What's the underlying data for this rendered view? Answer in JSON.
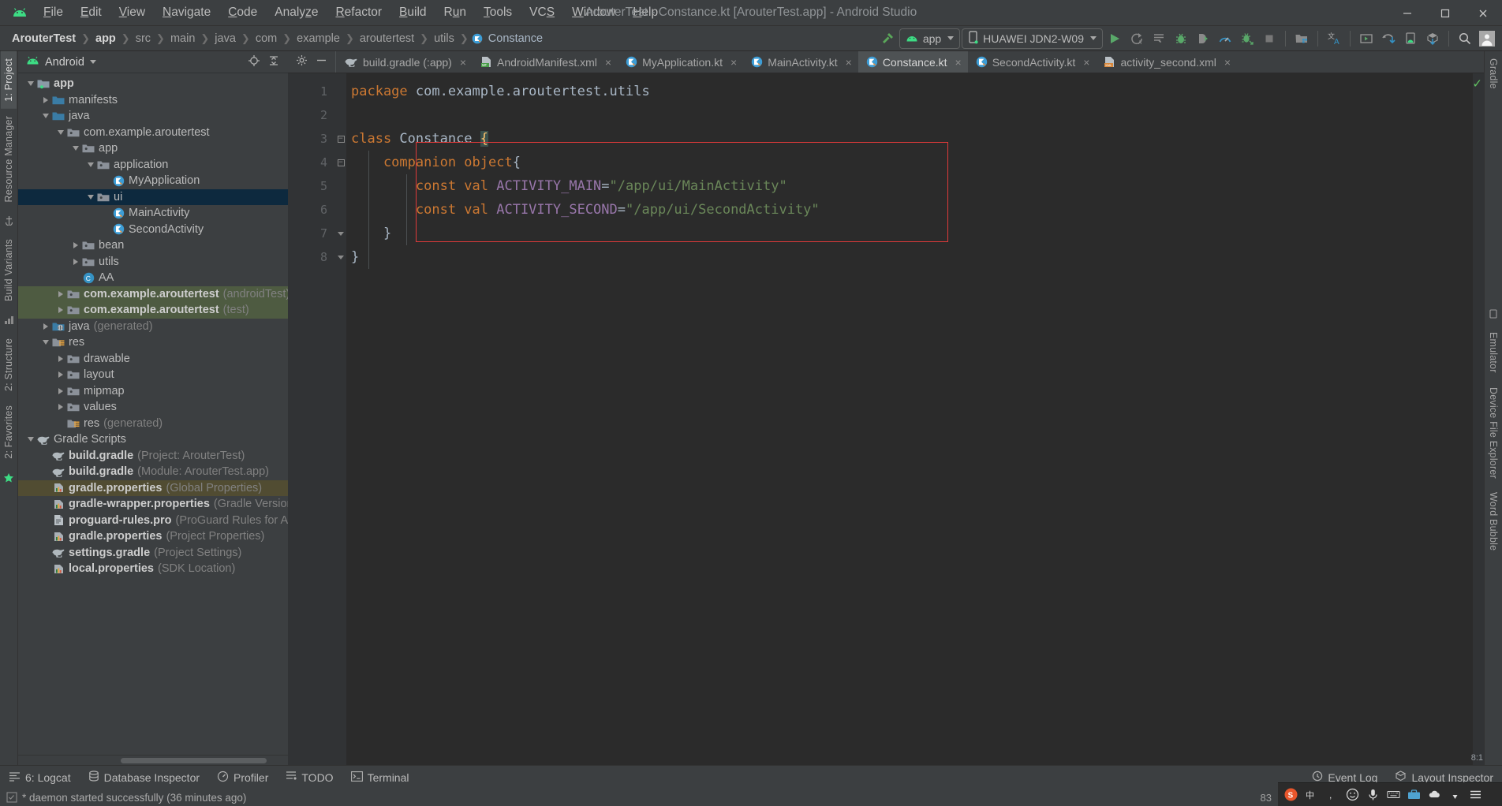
{
  "window": {
    "title": "ArouterTest - Constance.kt [ArouterTest.app] - Android Studio",
    "minimize": "—",
    "maximize": "☐",
    "close": "✕"
  },
  "menubar": {
    "logo": "android-logo-icon",
    "items": [
      {
        "label": "File",
        "mnemonic": "F"
      },
      {
        "label": "Edit",
        "mnemonic": "E"
      },
      {
        "label": "View",
        "mnemonic": "V"
      },
      {
        "label": "Navigate",
        "mnemonic": "N"
      },
      {
        "label": "Code",
        "mnemonic": "C"
      },
      {
        "label": "Analyze",
        "mnemonic": "z"
      },
      {
        "label": "Refactor",
        "mnemonic": "R"
      },
      {
        "label": "Build",
        "mnemonic": "B"
      },
      {
        "label": "Run",
        "mnemonic": "u"
      },
      {
        "label": "Tools",
        "mnemonic": "T"
      },
      {
        "label": "VCS",
        "mnemonic": "S"
      },
      {
        "label": "Window",
        "mnemonic": "W"
      },
      {
        "label": "Help",
        "mnemonic": "H"
      }
    ]
  },
  "breadcrumbs": [
    {
      "label": "ArouterTest",
      "style": "bold"
    },
    {
      "label": "app",
      "style": "bold"
    },
    {
      "label": "src",
      "style": "dim"
    },
    {
      "label": "main",
      "style": "dim"
    },
    {
      "label": "java",
      "style": "dim"
    },
    {
      "label": "com",
      "style": "dim"
    },
    {
      "label": "example",
      "style": "dim"
    },
    {
      "label": "aroutertest",
      "style": "dim"
    },
    {
      "label": "utils",
      "style": "dim"
    },
    {
      "label": "Constance",
      "style": "plain",
      "icon": "kotlin-class-icon"
    }
  ],
  "toolbar": {
    "build_hammer": "hammer-icon",
    "module_selector": {
      "label": "app",
      "icon": "android-app-icon"
    },
    "device_selector": {
      "label": "HUAWEI JDN2-W09",
      "icon": "device-phone-icon"
    },
    "actions": [
      {
        "name": "run-button",
        "icon": "play-icon"
      },
      {
        "name": "apply-changes-button",
        "icon": "apply-changes-icon"
      },
      {
        "name": "apply-code-changes-button",
        "icon": "apply-code-changes-icon"
      },
      {
        "name": "debug-button",
        "icon": "debug-bug-icon"
      },
      {
        "name": "attach-debugger-button",
        "icon": "attach-debugger-icon"
      },
      {
        "name": "profile-button",
        "icon": "profiler-gauge-icon"
      },
      {
        "name": "run-with-coverage-button",
        "icon": "coverage-icon"
      },
      {
        "name": "stop-button",
        "icon": "stop-square-icon"
      },
      {
        "name": "sdk-manager-button",
        "icon": "sdk-manager-icon"
      },
      {
        "name": "translate-button",
        "icon": "translate-icon"
      },
      {
        "name": "avd-manager-button",
        "icon": "avd-manager-icon"
      },
      {
        "name": "sync-gradle-button",
        "icon": "gradle-sync-icon"
      },
      {
        "name": "device-file-explorer-button",
        "icon": "device-explorer-icon"
      },
      {
        "name": "layout-inspector-button",
        "icon": "layout-inspector-icon"
      },
      {
        "name": "search-everywhere-button",
        "icon": "search-icon"
      },
      {
        "name": "account-button",
        "icon": "user-avatar-icon"
      }
    ]
  },
  "left_rail": {
    "tabs": [
      "1: Project",
      "Resource Manager",
      "Build Variants",
      "2: Structure",
      "2: Favorites"
    ],
    "bottom_icon": "favorites-star-icon"
  },
  "right_rail": {
    "tabs": [
      "Gradle",
      "Emulator",
      "Device File Explorer",
      "Word Bubble"
    ]
  },
  "project_panel": {
    "selector_label": "Android",
    "selector_icon": "android-logo-icon",
    "actions": [
      "locate-target-icon",
      "collapse-all-icon"
    ],
    "tree": [
      {
        "label": "app",
        "depth": 0,
        "twisty": "open",
        "icon": "module-folder-icon",
        "bold": true
      },
      {
        "label": "manifests",
        "depth": 1,
        "twisty": "closed",
        "icon": "folder-blue-icon"
      },
      {
        "label": "java",
        "depth": 1,
        "twisty": "open",
        "icon": "folder-blue-icon"
      },
      {
        "label": "com.example.aroutertest",
        "depth": 2,
        "twisty": "open",
        "icon": "package-icon"
      },
      {
        "label": "app",
        "depth": 3,
        "twisty": "open",
        "icon": "package-icon"
      },
      {
        "label": "application",
        "depth": 4,
        "twisty": "open",
        "icon": "package-icon"
      },
      {
        "label": "MyApplication",
        "depth": 5,
        "twisty": "none",
        "icon": "kotlin-class-icon"
      },
      {
        "label": "ui",
        "depth": 4,
        "twisty": "open",
        "icon": "package-icon",
        "selected": "blue"
      },
      {
        "label": "MainActivity",
        "depth": 5,
        "twisty": "none",
        "icon": "kotlin-class-icon"
      },
      {
        "label": "SecondActivity",
        "depth": 5,
        "twisty": "none",
        "icon": "kotlin-class-icon"
      },
      {
        "label": "bean",
        "depth": 3,
        "twisty": "closed",
        "icon": "package-icon"
      },
      {
        "label": "utils",
        "depth": 3,
        "twisty": "closed",
        "icon": "package-icon"
      },
      {
        "label": "AA",
        "depth": 3,
        "twisty": "none",
        "icon": "java-class-icon"
      },
      {
        "label": "com.example.aroutertest",
        "sub": "(androidTest)",
        "depth": 2,
        "twisty": "closed",
        "icon": "package-icon",
        "selected": "green",
        "bold": true
      },
      {
        "label": "com.example.aroutertest",
        "sub": "(test)",
        "depth": 2,
        "twisty": "closed",
        "icon": "package-icon",
        "selected": "green",
        "bold": true
      },
      {
        "label": "java",
        "sub": "(generated)",
        "depth": 1,
        "twisty": "closed",
        "icon": "folder-generated-icon"
      },
      {
        "label": "res",
        "depth": 1,
        "twisty": "open",
        "icon": "folder-res-icon"
      },
      {
        "label": "drawable",
        "depth": 2,
        "twisty": "closed",
        "icon": "package-icon"
      },
      {
        "label": "layout",
        "depth": 2,
        "twisty": "closed",
        "icon": "package-icon"
      },
      {
        "label": "mipmap",
        "depth": 2,
        "twisty": "closed",
        "icon": "package-icon"
      },
      {
        "label": "values",
        "depth": 2,
        "twisty": "closed",
        "icon": "package-icon"
      },
      {
        "label": "res",
        "sub": "(generated)",
        "depth": 2,
        "twisty": "none",
        "icon": "folder-res-icon"
      },
      {
        "label": "Gradle Scripts",
        "depth": 0,
        "twisty": "open",
        "icon": "gradle-elephant-icon"
      },
      {
        "label": "build.gradle",
        "sub": "(Project: ArouterTest)",
        "depth": 1,
        "twisty": "none",
        "icon": "gradle-elephant-icon",
        "bold": true
      },
      {
        "label": "build.gradle",
        "sub": "(Module: ArouterTest.app)",
        "depth": 1,
        "twisty": "none",
        "icon": "gradle-elephant-icon",
        "bold": true
      },
      {
        "label": "gradle.properties",
        "sub": "(Global Properties)",
        "depth": 1,
        "twisty": "none",
        "icon": "properties-icon",
        "bold": true,
        "selected": "olive"
      },
      {
        "label": "gradle-wrapper.properties",
        "sub": "(Gradle Version)",
        "depth": 1,
        "twisty": "none",
        "icon": "properties-icon",
        "bold": true
      },
      {
        "label": "proguard-rules.pro",
        "sub": "(ProGuard Rules for Aroute",
        "depth": 1,
        "twisty": "none",
        "icon": "text-file-icon",
        "bold": true
      },
      {
        "label": "gradle.properties",
        "sub": "(Project Properties)",
        "depth": 1,
        "twisty": "none",
        "icon": "properties-icon",
        "bold": true
      },
      {
        "label": "settings.gradle",
        "sub": "(Project Settings)",
        "depth": 1,
        "twisty": "none",
        "icon": "gradle-elephant-icon",
        "bold": true
      },
      {
        "label": "local.properties",
        "sub": "(SDK Location)",
        "depth": 1,
        "twisty": "none",
        "icon": "properties-icon",
        "bold": true
      }
    ]
  },
  "editor": {
    "tabs": [
      {
        "label": "build.gradle (:app)",
        "icon": "gradle-elephant-icon",
        "active": false
      },
      {
        "label": "AndroidManifest.xml",
        "icon": "manifest-xml-icon",
        "active": false
      },
      {
        "label": "MyApplication.kt",
        "icon": "kotlin-file-icon",
        "active": false
      },
      {
        "label": "MainActivity.kt",
        "icon": "kotlin-file-icon",
        "active": false
      },
      {
        "label": "Constance.kt",
        "icon": "kotlin-file-icon",
        "active": true
      },
      {
        "label": "SecondActivity.kt",
        "icon": "kotlin-file-icon",
        "active": false
      },
      {
        "label": "activity_second.xml",
        "icon": "layout-xml-icon",
        "active": false
      }
    ],
    "tab_close": "×",
    "gutter_lines": [
      "1",
      "2",
      "3",
      "4",
      "5",
      "6",
      "7",
      "8"
    ],
    "inspection_status": "ok-check-icon",
    "inspection_count": "8:1",
    "code_lines": [
      {
        "n": 1,
        "tokens": [
          {
            "t": "package ",
            "c": "kw"
          },
          {
            "t": "com.example.aroutertest.utils",
            "c": "id"
          }
        ]
      },
      {
        "n": 2,
        "tokens": []
      },
      {
        "n": 3,
        "tokens": [
          {
            "t": "class ",
            "c": "kw"
          },
          {
            "t": "Constance ",
            "c": "cls"
          },
          {
            "t": "{",
            "c": "brc-hl"
          }
        ]
      },
      {
        "n": 4,
        "tokens": [
          {
            "t": "    companion ",
            "c": "kw"
          },
          {
            "t": "object",
            "c": "kw"
          },
          {
            "t": "{",
            "c": "brc"
          }
        ]
      },
      {
        "n": 5,
        "tokens": [
          {
            "t": "        const val ",
            "c": "kw"
          },
          {
            "t": "ACTIVITY_MAIN",
            "c": "cnst"
          },
          {
            "t": "=",
            "c": "brc"
          },
          {
            "t": "\"/app/ui/MainActivity\"",
            "c": "str"
          }
        ]
      },
      {
        "n": 6,
        "tokens": [
          {
            "t": "        const val ",
            "c": "kw"
          },
          {
            "t": "ACTIVITY_SECOND",
            "c": "cnst"
          },
          {
            "t": "=",
            "c": "brc"
          },
          {
            "t": "\"/app/ui/SecondActivity\"",
            "c": "str"
          }
        ]
      },
      {
        "n": 7,
        "tokens": [
          {
            "t": "    }",
            "c": "brc"
          }
        ]
      },
      {
        "n": 8,
        "tokens": [
          {
            "t": "}",
            "c": "brc"
          }
        ]
      }
    ],
    "highlight_box_color": "#e03a3a"
  },
  "bottom_bar": {
    "left_items": [
      {
        "label": "6: Logcat",
        "icon": "logcat-icon"
      },
      {
        "label": "Database Inspector",
        "icon": "database-icon"
      },
      {
        "label": "Profiler",
        "icon": "profiler-gauge-icon"
      },
      {
        "label": "TODO",
        "icon": "todo-icon"
      },
      {
        "label": "Terminal",
        "icon": "terminal-icon"
      }
    ],
    "right_items": [
      {
        "label": "Event Log",
        "icon": "event-log-icon"
      },
      {
        "label": "Layout Inspector",
        "icon": "layout-inspector-icon"
      }
    ]
  },
  "status_bar": {
    "icon": "build-status-icon",
    "message": "* daemon started successfully (36 minutes ago)"
  },
  "taskbar": {
    "percent": "83",
    "icons": [
      "sogou-s-icon",
      "ime-cn-icon",
      "comma-icon",
      "emoji-icon",
      "mic-icon",
      "keyboard-icon",
      "toolbox-icon",
      "cloud-icon",
      "pin-icon",
      "menu-icon"
    ]
  },
  "colors": {
    "chrome": "#3c3f41",
    "editor_bg": "#2b2b2b",
    "gutter_bg": "#313335",
    "accent_green": "#62c462",
    "select_blue": "#0d293e",
    "select_green": "#4e5b41",
    "select_olive": "#514c32",
    "keyword": "#cc7832",
    "string": "#6a8759",
    "constant": "#9876aa",
    "text": "#a9b7c6"
  }
}
